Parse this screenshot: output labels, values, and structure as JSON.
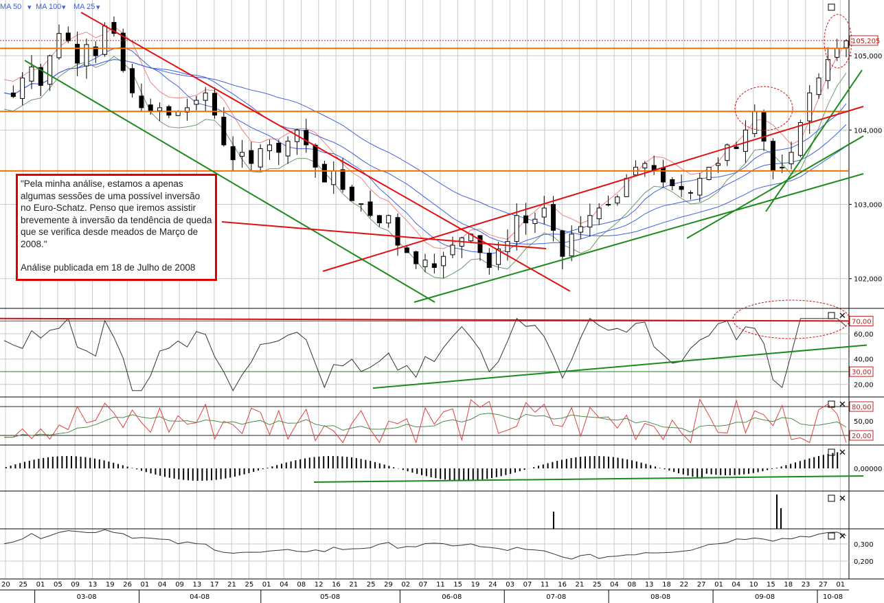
{
  "toolbar": {
    "ma_labels": [
      "MA 50",
      "MA 100",
      "MA 25"
    ]
  },
  "annotation": {
    "quote": "\"Pela minha análise, estamos a apenas algumas sessões de uma possível inversão no Euro-Schatz. Penso que iremos assistir brevemente à inversão da tendência de queda que se verifica desde meados de Março de 2008.\"",
    "published": "Análise publicada em 18 de Julho de 2008"
  },
  "colors": {
    "candle_up": "#ffffff",
    "candle_down": "#000000",
    "support_line": "#1a8a1a",
    "resistance_line": "#e01010",
    "horizontal_level": "#f07000",
    "ma_fast": "#f08080",
    "ma_slow": "#4060e0",
    "grid": "#c8c8c8"
  },
  "chart_data": [
    {
      "type": "candlestick",
      "panel": "price",
      "y_ticks": [
        "102,000",
        "103,000",
        "104,000",
        "105,000"
      ],
      "ylim": [
        101.6,
        105.75
      ],
      "price_badge": "105,205",
      "last_price": 105.205,
      "horizontal_levels": [
        105.1,
        104.25,
        103.45
      ],
      "x_day_labels": [
        "20",
        "25",
        "01",
        "05",
        "09",
        "13",
        "19",
        "26",
        "01",
        "04",
        "09",
        "13",
        "17",
        "21",
        "25",
        "01",
        "04",
        "08",
        "12",
        "16",
        "21",
        "25",
        "29",
        "02",
        "07",
        "11",
        "15",
        "19",
        "24",
        "03",
        "07",
        "11",
        "16",
        "21",
        "25",
        "04",
        "08",
        "13",
        "18",
        "22",
        "27",
        "01",
        "04",
        "10",
        "15",
        "18",
        "23",
        "27",
        "01"
      ],
      "x_month_labels": [
        "03-08",
        "04-08",
        "05-08",
        "06-08",
        "07-08",
        "08-08",
        "09-08",
        "10-08"
      ],
      "close_path": [
        104.5,
        104.45,
        104.7,
        104.85,
        104.6,
        105.0,
        105.3,
        105.2,
        104.9,
        105.15,
        105.0,
        105.4,
        105.3,
        104.8,
        104.5,
        104.3,
        104.25,
        104.3,
        104.2,
        104.25,
        104.3,
        104.4,
        104.5,
        104.2,
        103.8,
        103.6,
        103.7,
        103.55,
        103.75,
        103.8,
        103.7,
        103.85,
        104.0,
        103.8,
        103.5,
        103.3,
        103.45,
        103.2,
        103.05,
        103.0,
        102.85,
        102.75,
        102.85,
        102.45,
        102.35,
        102.2,
        102.25,
        102.15,
        102.3,
        102.45,
        102.55,
        102.6,
        102.35,
        102.15,
        102.4,
        102.5,
        102.85,
        102.75,
        102.8,
        102.95,
        102.65,
        102.3,
        102.6,
        102.7,
        102.85,
        102.95,
        103.0,
        103.1,
        103.35,
        103.5,
        103.55,
        103.45,
        103.3,
        103.25,
        103.2,
        103.15,
        103.35,
        103.5,
        103.55,
        103.8,
        103.75,
        104.0,
        104.25,
        103.85,
        103.45,
        103.5,
        103.7,
        104.1,
        104.5,
        104.7,
        104.95,
        105.1,
        105.2
      ],
      "trendlines_green": [
        [
          36,
          88,
          633,
          440
        ],
        [
          603,
          440,
          1257,
          253
        ],
        [
          1000,
          347,
          1257,
          198
        ],
        [
          1115,
          308,
          1255,
          102
        ]
      ],
      "trendlines_red": [
        [
          118,
          18,
          830,
          424
        ],
        [
          470,
          395,
          1257,
          155
        ],
        [
          323,
          323,
          795,
          362
        ]
      ],
      "ellipses": [
        [
          1112,
          158,
          42,
          32
        ],
        [
          1220,
          60,
          20,
          39
        ]
      ]
    },
    {
      "type": "line",
      "panel": "rsi",
      "y_ticks": [
        "20,00",
        "40,00",
        "60,00"
      ],
      "levels": [
        "70,00",
        "30,00"
      ],
      "ylim": [
        10,
        80
      ]
    },
    {
      "type": "line",
      "panel": "stochastic",
      "y_ticks": [
        "50,00"
      ],
      "levels": [
        "80,00",
        "20,00"
      ],
      "ylim": [
        0,
        100
      ]
    },
    {
      "type": "bar",
      "panel": "macd_histogram",
      "y_ticks": [
        "0,00000"
      ]
    },
    {
      "type": "bar",
      "panel": "volume",
      "y_ticks": []
    },
    {
      "type": "line",
      "panel": "oscillator",
      "y_ticks": [
        "0,300",
        "0,200"
      ]
    }
  ]
}
